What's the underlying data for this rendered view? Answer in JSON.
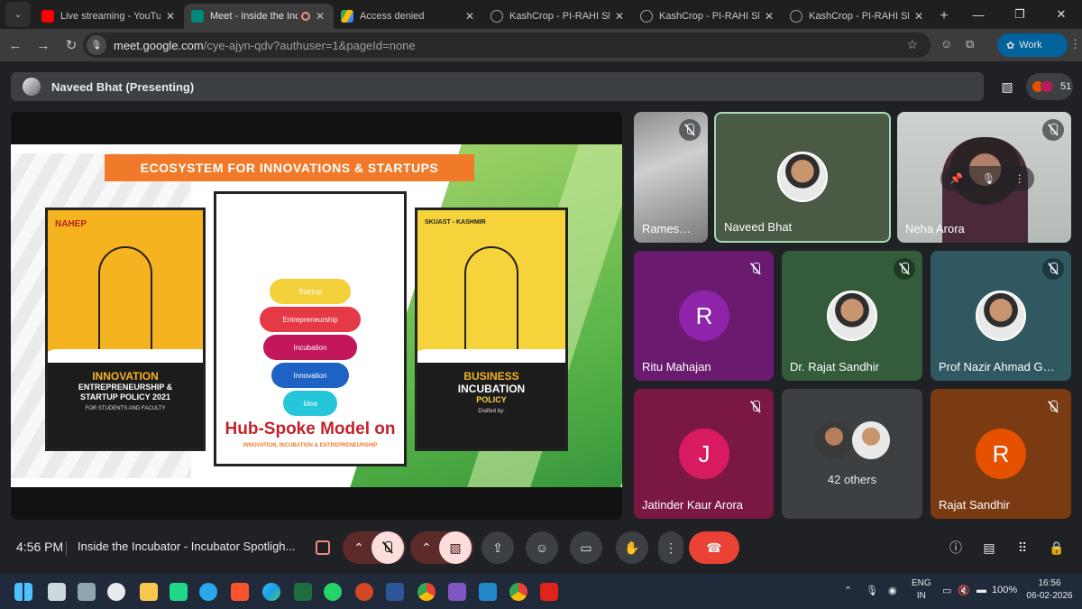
{
  "browser": {
    "tabs": [
      {
        "title": "Live streaming - YouTube S",
        "favicon_color": "#ff0000",
        "active": false
      },
      {
        "title": "Meet - Inside the Incub",
        "favicon_color": "#00897b",
        "active": true
      },
      {
        "title": "Access denied",
        "favicon_color": "#fbbc04",
        "active": false
      },
      {
        "title": "KashCrop - PI-RAHI Showc",
        "favicon_color": "#9aa0a6",
        "active": false
      },
      {
        "title": "KashCrop - PI-RAHI Showc",
        "favicon_color": "#9aa0a6",
        "active": false
      },
      {
        "title": "KashCrop - PI-RAHI Showc",
        "favicon_color": "#9aa0a6",
        "active": false
      }
    ],
    "url_host": "meet.google.com",
    "url_path": "/cye-ajyn-qdv?authuser=1&pageId=none",
    "profile_label": "Work"
  },
  "meet": {
    "presenter_label": "Naveed Bhat (Presenting)",
    "participant_count": "51",
    "slide": {
      "banner": "ECOSYSTEM FOR INNOVATIONS & STARTUPS",
      "left_book": {
        "logo": "NAHEP",
        "line1": "INNOVATION",
        "line2": "ENTREPRENEURSHIP &",
        "line3": "STARTUP POLICY 2021",
        "line4": "FOR STUDENTS AND FACULTY"
      },
      "right_book": {
        "logo": "SKUAST - KASHMIR",
        "line1": "BUSINESS",
        "line2": "INCUBATION",
        "line3": "POLICY",
        "line4": "Drafted by:"
      },
      "tiers": [
        "Startup",
        "Entrepreneurship",
        "Incubation",
        "Innovation",
        "Idea"
      ],
      "hub_title": "Hub-Spoke Model on",
      "hub_subtitle": "INNOVATION, INCUBATION & ENTREPRENEURSHIP"
    },
    "tiles": [
      {
        "name": "Rames…",
        "type": "video",
        "muted": true
      },
      {
        "name": "Naveed Bhat",
        "type": "photo",
        "muted": false,
        "active_speaker": true
      },
      {
        "name": "Neha Arora",
        "type": "video",
        "muted": true
      },
      {
        "name": "Ritu Mahajan",
        "type": "letter",
        "letter": "R",
        "bg": "#6a1b6f",
        "avatar": "#8e24aa",
        "muted": true
      },
      {
        "name": "Dr. Rajat Sandhir",
        "type": "photo",
        "bg": "#345b3a",
        "muted": true
      },
      {
        "name": "Prof Nazir Ahmad G…",
        "type": "photo",
        "bg": "#2f5860",
        "muted": true
      },
      {
        "name": "Jatinder Kaur Arora",
        "type": "letter",
        "letter": "J",
        "bg": "#7a1843",
        "avatar": "#d81b60",
        "muted": true
      },
      {
        "name": "42 others",
        "type": "others"
      },
      {
        "name": "Rajat Sandhir",
        "type": "letter",
        "letter": "R",
        "bg": "#7a3a12",
        "avatar": "#e65100",
        "muted": true
      }
    ],
    "bottom": {
      "time": "4:56 PM",
      "meeting_title": "Inside the Incubator - Incubator Spotligh..."
    }
  },
  "taskbar": {
    "lang1": "ENG",
    "lang2": "IN",
    "battery": "100%",
    "time": "16:56",
    "date": "06-02-2026"
  }
}
